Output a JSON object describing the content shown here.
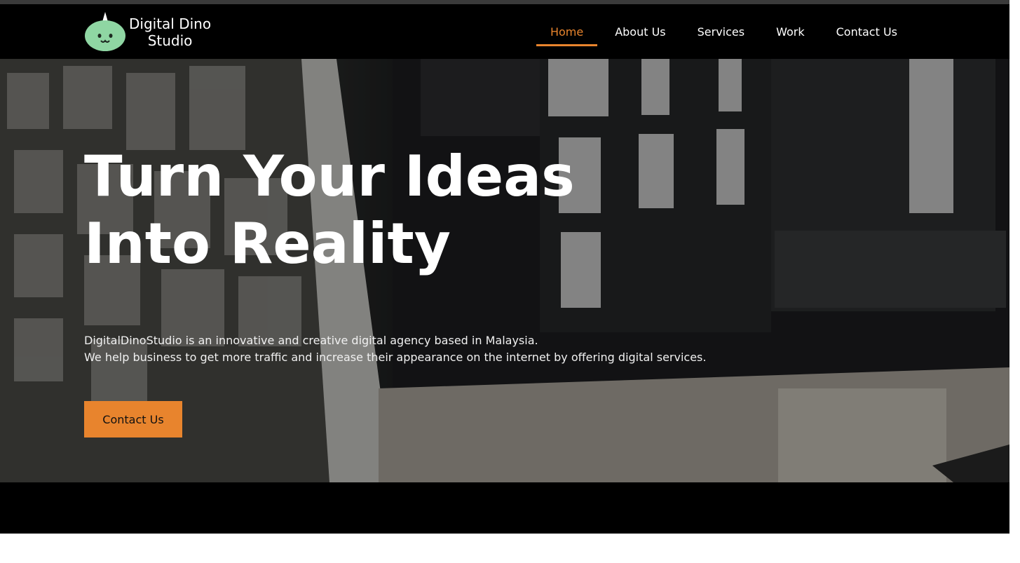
{
  "brand": {
    "name_line1": "Digital Dino",
    "name_line2": "Studio",
    "mascot_icon": "dino-mascot-icon",
    "mascot_color": "#8fd6a3"
  },
  "nav": {
    "items": [
      {
        "label": "Home",
        "active": true
      },
      {
        "label": "About Us",
        "active": false
      },
      {
        "label": "Services",
        "active": false
      },
      {
        "label": "Work",
        "active": false
      },
      {
        "label": "Contact Us",
        "active": false
      }
    ]
  },
  "hero": {
    "title_line1": "Turn Your Ideas",
    "title_line2": "Into Reality",
    "desc_line1": "DigitalDinoStudio is an innovative and creative digital agency based in Malaysia.",
    "desc_line2": "We help business to get more traffic and increase their appearance on the internet by offering digital services.",
    "cta_label": "Contact Us"
  },
  "colors": {
    "accent": "#e8842d",
    "nav_bg": "#000000",
    "text": "#ffffff"
  }
}
